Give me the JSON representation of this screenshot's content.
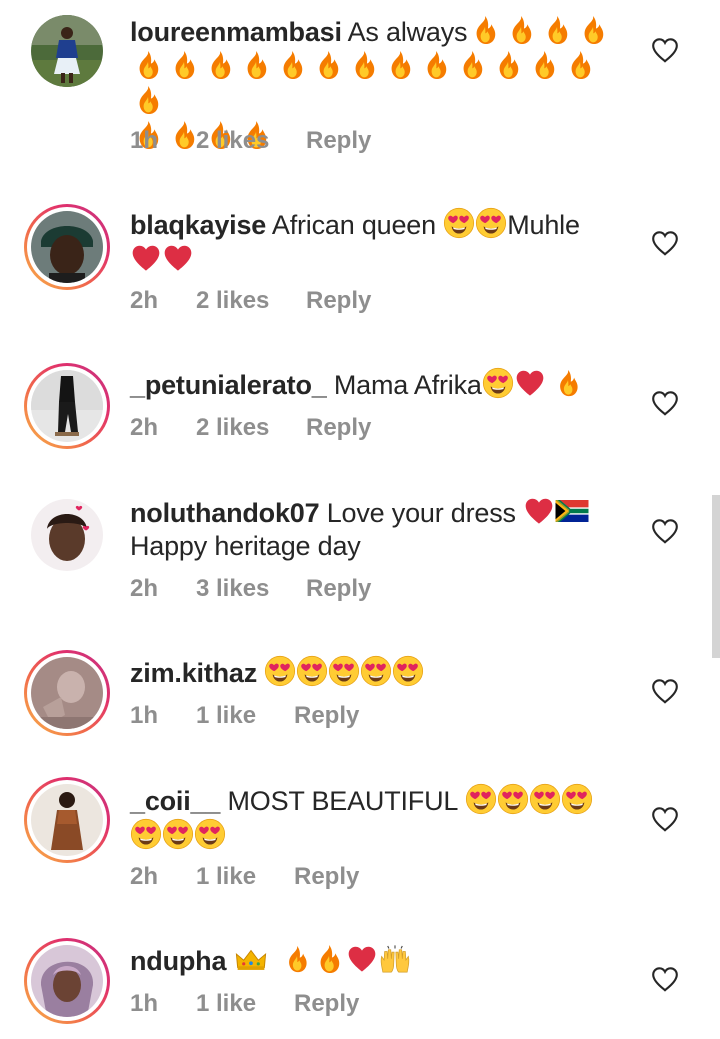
{
  "comments": [
    {
      "username": "loureenmambasi",
      "text": "As always",
      "emoji_line1": [
        "fire",
        "fire",
        "fire",
        "fire"
      ],
      "emoji_line2": [
        "fire",
        "fire",
        "fire",
        "fire",
        "fire",
        "fire",
        "fire",
        "fire",
        "fire",
        "fire",
        "fire",
        "fire",
        "fire",
        "fire"
      ],
      "emoji_line3": [
        "fire",
        "fire",
        "fire",
        "fire"
      ],
      "time": "1h",
      "likes": "2 likes",
      "reply": "Reply",
      "avatar_ring": false
    },
    {
      "username": "blaqkayise",
      "text": "African queen",
      "text_after": "Muhle",
      "time": "2h",
      "likes": "2 likes",
      "reply": "Reply",
      "avatar_ring": true
    },
    {
      "username": "_petunialerato_",
      "text": "Mama Afrika",
      "time": "2h",
      "likes": "2 likes",
      "reply": "Reply",
      "avatar_ring": true
    },
    {
      "username": "noluthandok07",
      "text": "Love your dress",
      "text_line2": "Happy heritage day",
      "time": "2h",
      "likes": "3 likes",
      "reply": "Reply",
      "avatar_ring": false
    },
    {
      "username": "zim.kithaz",
      "text": "",
      "time": "1h",
      "likes": "1 like",
      "reply": "Reply",
      "avatar_ring": true
    },
    {
      "username": "_coii__",
      "text": "MOST BEAUTIFUL",
      "time": "2h",
      "likes": "1 like",
      "reply": "Reply",
      "avatar_ring": true
    },
    {
      "username": "ndupha",
      "text": "",
      "time": "1h",
      "likes": "1 like",
      "reply": "Reply",
      "avatar_ring": true
    }
  ],
  "icons": {
    "like": "heart-outline-icon",
    "fire": "fire-emoji",
    "heart_eyes": "heart-eyes-emoji",
    "red_heart": "red-heart-emoji",
    "flag": "south-africa-flag-emoji",
    "crown": "crown-emoji",
    "raised_hands": "raised-hands-emoji"
  },
  "colors": {
    "text": "#262626",
    "meta": "#8e8e8e",
    "story_ring_start": "#f9b649",
    "story_ring_end": "#c13584"
  }
}
